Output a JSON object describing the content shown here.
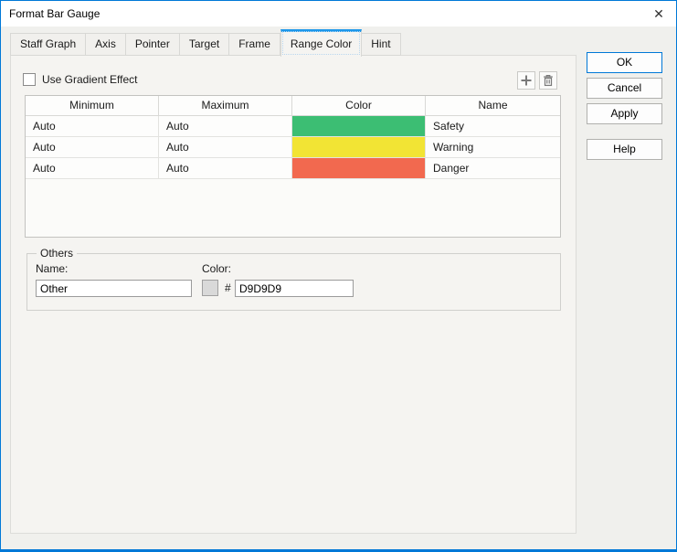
{
  "window": {
    "title": "Format Bar Gauge",
    "close_glyph": "✕"
  },
  "tabs": [
    {
      "label": "Staff Graph",
      "active": false
    },
    {
      "label": "Axis",
      "active": false
    },
    {
      "label": "Pointer",
      "active": false
    },
    {
      "label": "Target",
      "active": false
    },
    {
      "label": "Frame",
      "active": false
    },
    {
      "label": "Range Color",
      "active": true
    },
    {
      "label": "Hint",
      "active": false
    }
  ],
  "panel": {
    "gradient_checkbox_label": "Use Gradient Effect",
    "gradient_checked": false,
    "toolbar": {
      "add_icon": "plus-icon",
      "delete_icon": "trash-icon"
    },
    "table": {
      "headers": [
        "Minimum",
        "Maximum",
        "Color",
        "Name"
      ],
      "rows": [
        {
          "minimum": "Auto",
          "maximum": "Auto",
          "color": "#3cbe73",
          "name": "Safety"
        },
        {
          "minimum": "Auto",
          "maximum": "Auto",
          "color": "#f2e434",
          "name": "Warning"
        },
        {
          "minimum": "Auto",
          "maximum": "Auto",
          "color": "#f2694f",
          "name": "Danger"
        }
      ]
    },
    "others": {
      "legend": "Others",
      "name_label": "Name:",
      "name_value": "Other",
      "color_label": "Color:",
      "hash": "#",
      "color_value": "D9D9D9",
      "swatch_color": "#d9d9d9"
    }
  },
  "buttons": [
    {
      "label": "OK",
      "default": true
    },
    {
      "label": "Cancel",
      "default": false
    },
    {
      "label": "Apply",
      "default": false
    },
    {
      "label": "Help",
      "default": false
    }
  ],
  "colors": {
    "accent": "#0078d7",
    "tab_indicator": "#1c97ea",
    "titlebar_bg": "#ffffff",
    "dialog_bg": "#f0f0ed",
    "panel_bg": "#f5f4f1"
  }
}
